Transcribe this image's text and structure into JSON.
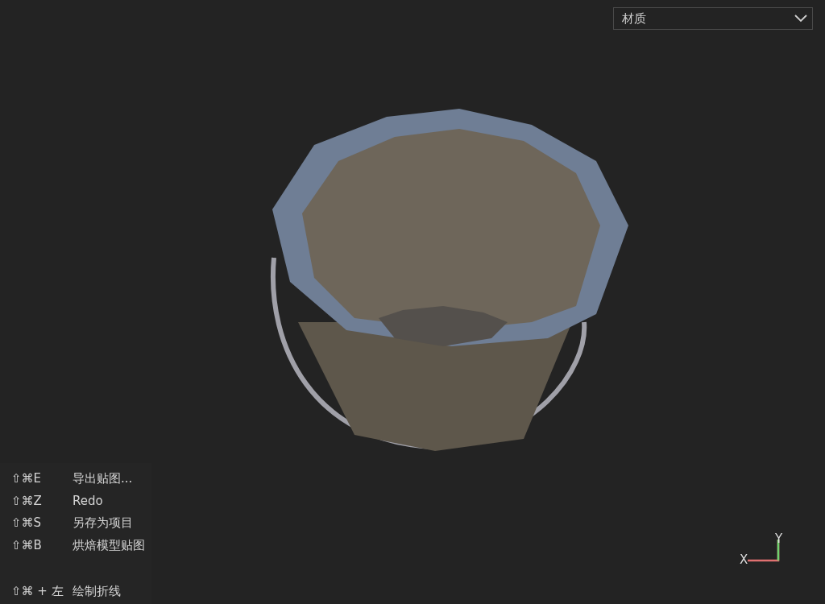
{
  "view_dropdown": {
    "value": "材质"
  },
  "shortcuts": [
    {
      "keys": "⇧⌘E",
      "action": "导出贴图..."
    },
    {
      "keys": "⇧⌘Z",
      "action": "Redo"
    },
    {
      "keys": "⇧⌘S",
      "action": "另存为项目"
    },
    {
      "keys": "⇧⌘B",
      "action": "烘焙模型贴图"
    }
  ],
  "mouse_shortcut": {
    "keys": "⇧⌘ + 左",
    "action": "绘制折线"
  },
  "axis_gizmo": {
    "x_label": "X",
    "y_label": "Y"
  }
}
